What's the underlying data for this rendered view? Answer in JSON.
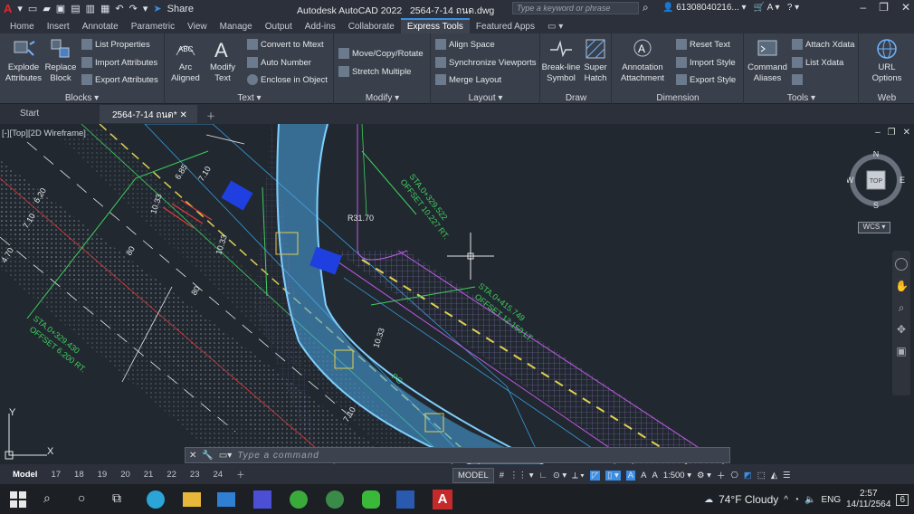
{
  "app": {
    "logo": "A",
    "title": "Autodesk AutoCAD 2022",
    "file": "2564-7-14 ถนด.dwg",
    "share_label": "Share",
    "search_placeholder": "Type a keyword or phrase",
    "user": "61308040216..."
  },
  "ribbon_tabs": [
    "Home",
    "Insert",
    "Annotate",
    "Parametric",
    "View",
    "Manage",
    "Output",
    "Add-ins",
    "Collaborate",
    "Express Tools",
    "Featured Apps"
  ],
  "active_tab": "Express Tools",
  "panels": {
    "blocks": {
      "title": "Blocks",
      "explode": "Explode\nAttributes",
      "replace": "Replace\nBlock",
      "list_properties": "List Properties",
      "import_attributes": "Import Attributes",
      "export_attributes": "Export Attributes"
    },
    "text": {
      "title": "Text",
      "arc_aligned": "Arc\nAligned",
      "modify_text": "Modify\nText",
      "convert_mtext": "Convert to Mtext",
      "auto_number": "Auto Number",
      "enclose_object": "Enclose in Object"
    },
    "modify": {
      "title": "Modify",
      "move_copy_rotate": "Move/Copy/Rotate",
      "stretch_multiple": "Stretch Multiple"
    },
    "layout": {
      "title": "Layout",
      "align_space": "Align Space",
      "sync_viewports": "Synchronize Viewports",
      "merge_layout": "Merge Layout"
    },
    "draw": {
      "title": "Draw",
      "breakline": "Break-line\nSymbol",
      "super_hatch": "Super\nHatch"
    },
    "dimension": {
      "title": "Dimension",
      "annotation_attachment": "Annotation\nAttachment",
      "reset_text": "Reset Text",
      "import_style": "Import Style",
      "export_style": "Export Style"
    },
    "tools": {
      "title": "Tools",
      "command_aliases": "Command\nAliases",
      "attach_xdata": "Attach Xdata",
      "list_xdata": "List Xdata"
    },
    "web": {
      "title": "Web",
      "url_options": "URL\nOptions"
    }
  },
  "doc_tabs": [
    {
      "label": "Start"
    },
    {
      "label": "2564-7-14 ถนด*"
    }
  ],
  "viewport": {
    "label": "[-][Top][2D Wireframe]",
    "compass": {
      "n": "N",
      "s": "S",
      "e": "E",
      "w": "W",
      "top": "TOP",
      "wcs": "WCS"
    },
    "annotations": {
      "sta1": "STA.0+329.430",
      "off1": "OFFSET 6.200 RT.",
      "sta2": "STA.0+415.749",
      "off2": "OFFSET 12.150 LT.",
      "sta3": "STA.0+329.522",
      "off3": "OFFSET 10.227 RT.",
      "r1": "R31.70",
      "d1": "10.33",
      "d2": "10.33",
      "d3": "6.20",
      "d4": "7.10",
      "d5": "6.85",
      "d6": "7.10",
      "d7": "80",
      "d8": "80",
      "d9": "10.33",
      "pc": "PC",
      "d10": "4.70",
      "d11": "7.10"
    },
    "axis_y": "Y",
    "axis_x": "X"
  },
  "command_placeholder": "Type a command",
  "layout_tabs": [
    "Model",
    "17",
    "18",
    "19",
    "20",
    "21",
    "22",
    "23",
    "24"
  ],
  "status": {
    "model": "MODEL",
    "scale": "1:500"
  },
  "tray": {
    "weather": "74°F  Cloudy",
    "lang": "ENG",
    "time": "2:57",
    "date": "14/11/2564",
    "notif": "6"
  }
}
